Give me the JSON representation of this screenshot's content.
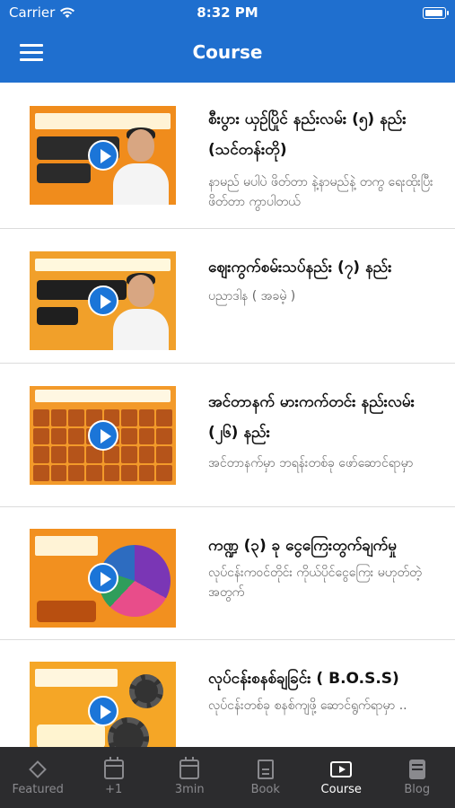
{
  "status_bar": {
    "carrier": "Carrier",
    "time": "8:32 PM",
    "battery_level": 1.0
  },
  "nav": {
    "title": "Course",
    "menu_icon": "hamburger-menu-icon"
  },
  "courses": [
    {
      "title": "စီးပွား ယှဉ်ပြိုင် နည်းလမ်း (၅) နည်း (သင်တန်းတို)",
      "subtitle": "နာမည် မပါပဲ ဖိတ်တာ နဲ့နာမည်နဲ့ တကွ ရေးထိုးပြီး ဖိတ်တာ ကွာပါတယ်"
    },
    {
      "title": "ဈေးကွက်စမ်းသပ်နည်း (၇) နည်း",
      "subtitle": "ပညာဒါန ( အခမဲ့ )"
    },
    {
      "title": "အင်တာနက် မားကက်တင်း နည်းလမ်း (၂၆) နည်း",
      "subtitle": "အင်တာနက်မှာ ဘရန်းတစ်ခု ဖော်ဆောင်ရာမှာ"
    },
    {
      "title": "ကဏ္ဍ (၃) ခု ငွေကြေးတွက်ချက်မှု",
      "subtitle": "လုပ်ငန်းကဝင်တိုင်း ကိုယ်ပိုင်ငွေကြေး မဟုတ်တဲ့အတွက်"
    },
    {
      "title": "လုပ်ငန်းစနစ်ချခြင်း ( B.O.S.S)",
      "subtitle": "လုပ်ငန်းတစ်ခု စနစ်ကျဖို့ ဆောင်ရွက်ရာမှာ .."
    }
  ],
  "tabs": [
    {
      "label": "Featured",
      "icon": "diamond-icon",
      "active": false
    },
    {
      "label": "+1",
      "icon": "calendar-icon",
      "active": false
    },
    {
      "label": "3min",
      "icon": "calendar-icon",
      "active": false
    },
    {
      "label": "Book",
      "icon": "book-icon",
      "active": false
    },
    {
      "label": "Course",
      "icon": "video-icon",
      "active": true
    },
    {
      "label": "Blog",
      "icon": "blog-icon",
      "active": false
    }
  ]
}
